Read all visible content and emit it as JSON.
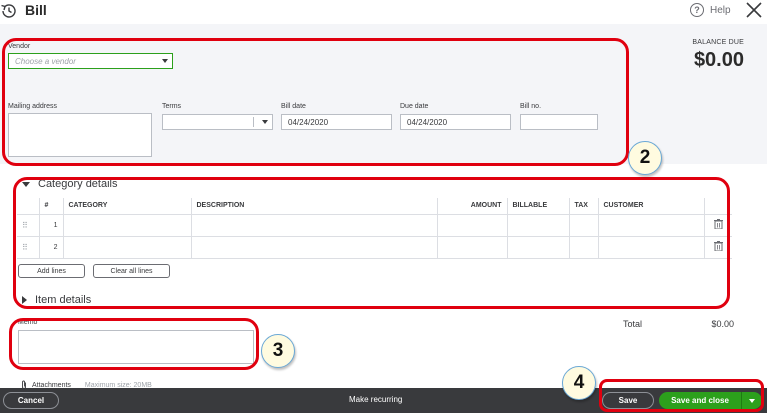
{
  "header": {
    "title": "Bill",
    "help_label": "Help"
  },
  "balance": {
    "label": "BALANCE DUE",
    "value": "$0.00"
  },
  "form": {
    "vendor_label": "Vendor",
    "vendor_placeholder": "Choose a vendor",
    "mailing_label": "Mailing address",
    "terms_label": "Terms",
    "bill_date_label": "Bill date",
    "bill_date_value": "04/24/2020",
    "due_date_label": "Due date",
    "due_date_value": "04/24/2020",
    "bill_no_label": "Bill no."
  },
  "category": {
    "section_title": "Category details",
    "columns": [
      "#",
      "CATEGORY",
      "DESCRIPTION",
      "AMOUNT",
      "BILLABLE",
      "TAX",
      "CUSTOMER"
    ],
    "rows": [
      {
        "num": "1"
      },
      {
        "num": "2"
      }
    ],
    "add_lines": "Add lines",
    "clear_lines": "Clear all lines"
  },
  "item": {
    "section_title": "Item details"
  },
  "memo": {
    "label": "Memo"
  },
  "totals": {
    "label": "Total",
    "value": "$0.00"
  },
  "attachments": {
    "label": "Attachments",
    "max_size": "Maximum size: 20MB"
  },
  "footer": {
    "cancel": "Cancel",
    "make_recurring": "Make recurring",
    "save": "Save",
    "save_and_close": "Save and close"
  },
  "annotations": [
    "2",
    "3",
    "4"
  ],
  "icons": {
    "history": "history-icon",
    "help": "help-icon",
    "close": "close-icon",
    "trash": "trash-icon",
    "drag": "drag-handle-icon",
    "paperclip": "paperclip-icon"
  },
  "colors": {
    "accent_green": "#2ca01c",
    "annotation_red": "#e0000f",
    "footer_bg": "#393a3d"
  }
}
